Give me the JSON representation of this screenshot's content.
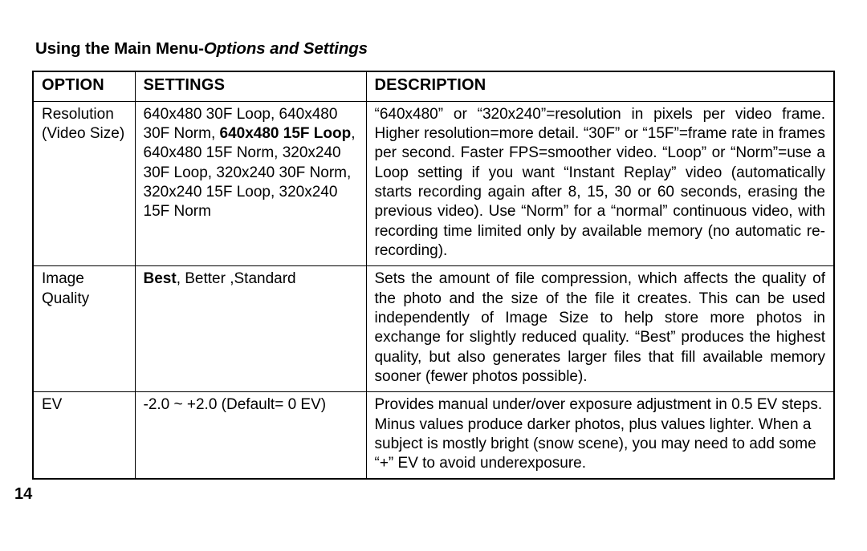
{
  "heading_a": "Using the Main Menu-",
  "heading_b": "Options and Settings",
  "columns": {
    "c1": "OPTION",
    "c2": "SETTINGS",
    "c3": "DESCRIPTION"
  },
  "rows": {
    "r1": {
      "option_a": "Resolution",
      "option_b": "(Video Size)",
      "settings_a": "640x480 30F Loop, 640x480 30F Norm, ",
      "settings_b": "640x480 15F Loop",
      "settings_c": ", 640x480 15F Norm, 320x240 30F Loop, 320x240 30F Norm, 320x240 15F Loop, 320x240 15F Norm",
      "desc": "“640x480” or “320x240”=resolution in pixels per video frame. Higher resolution=more detail. “30F” or “15F”=frame rate in frames per second. Faster FPS=smoother video. “Loop” or “Norm”=use a Loop setting if you want “Instant Replay” video (automatically starts recording again after 8, 15, 30 or 60 seconds, erasing the previous video).  Use “Norm” for a “normal” continuous video, with recording time limited only by available memory (no automatic re-recording)."
    },
    "r2": {
      "option_a": "Image",
      "option_b": "Quality",
      "settings_a": "Best",
      "settings_b": ", Better ,Standard",
      "desc": "Sets the amount of file compression, which affects the quality of the photo and the size of the file it creates. This can be used independently of Image Size to help store more photos in exchange for slightly reduced quality. “Best” produces the highest quality, but also generates larger files that fill available memory sooner (fewer photos possible)."
    },
    "r3": {
      "option": "EV",
      "settings": "-2.0 ~ +2.0 (Default= 0 EV)",
      "desc": "Provides manual under/over exposure adjustment in 0.5 EV steps. Minus values produce darker photos, plus values lighter. When a subject is mostly bright (snow scene), you may need to add some “+” EV to avoid underexposure."
    }
  },
  "page_number": "14"
}
